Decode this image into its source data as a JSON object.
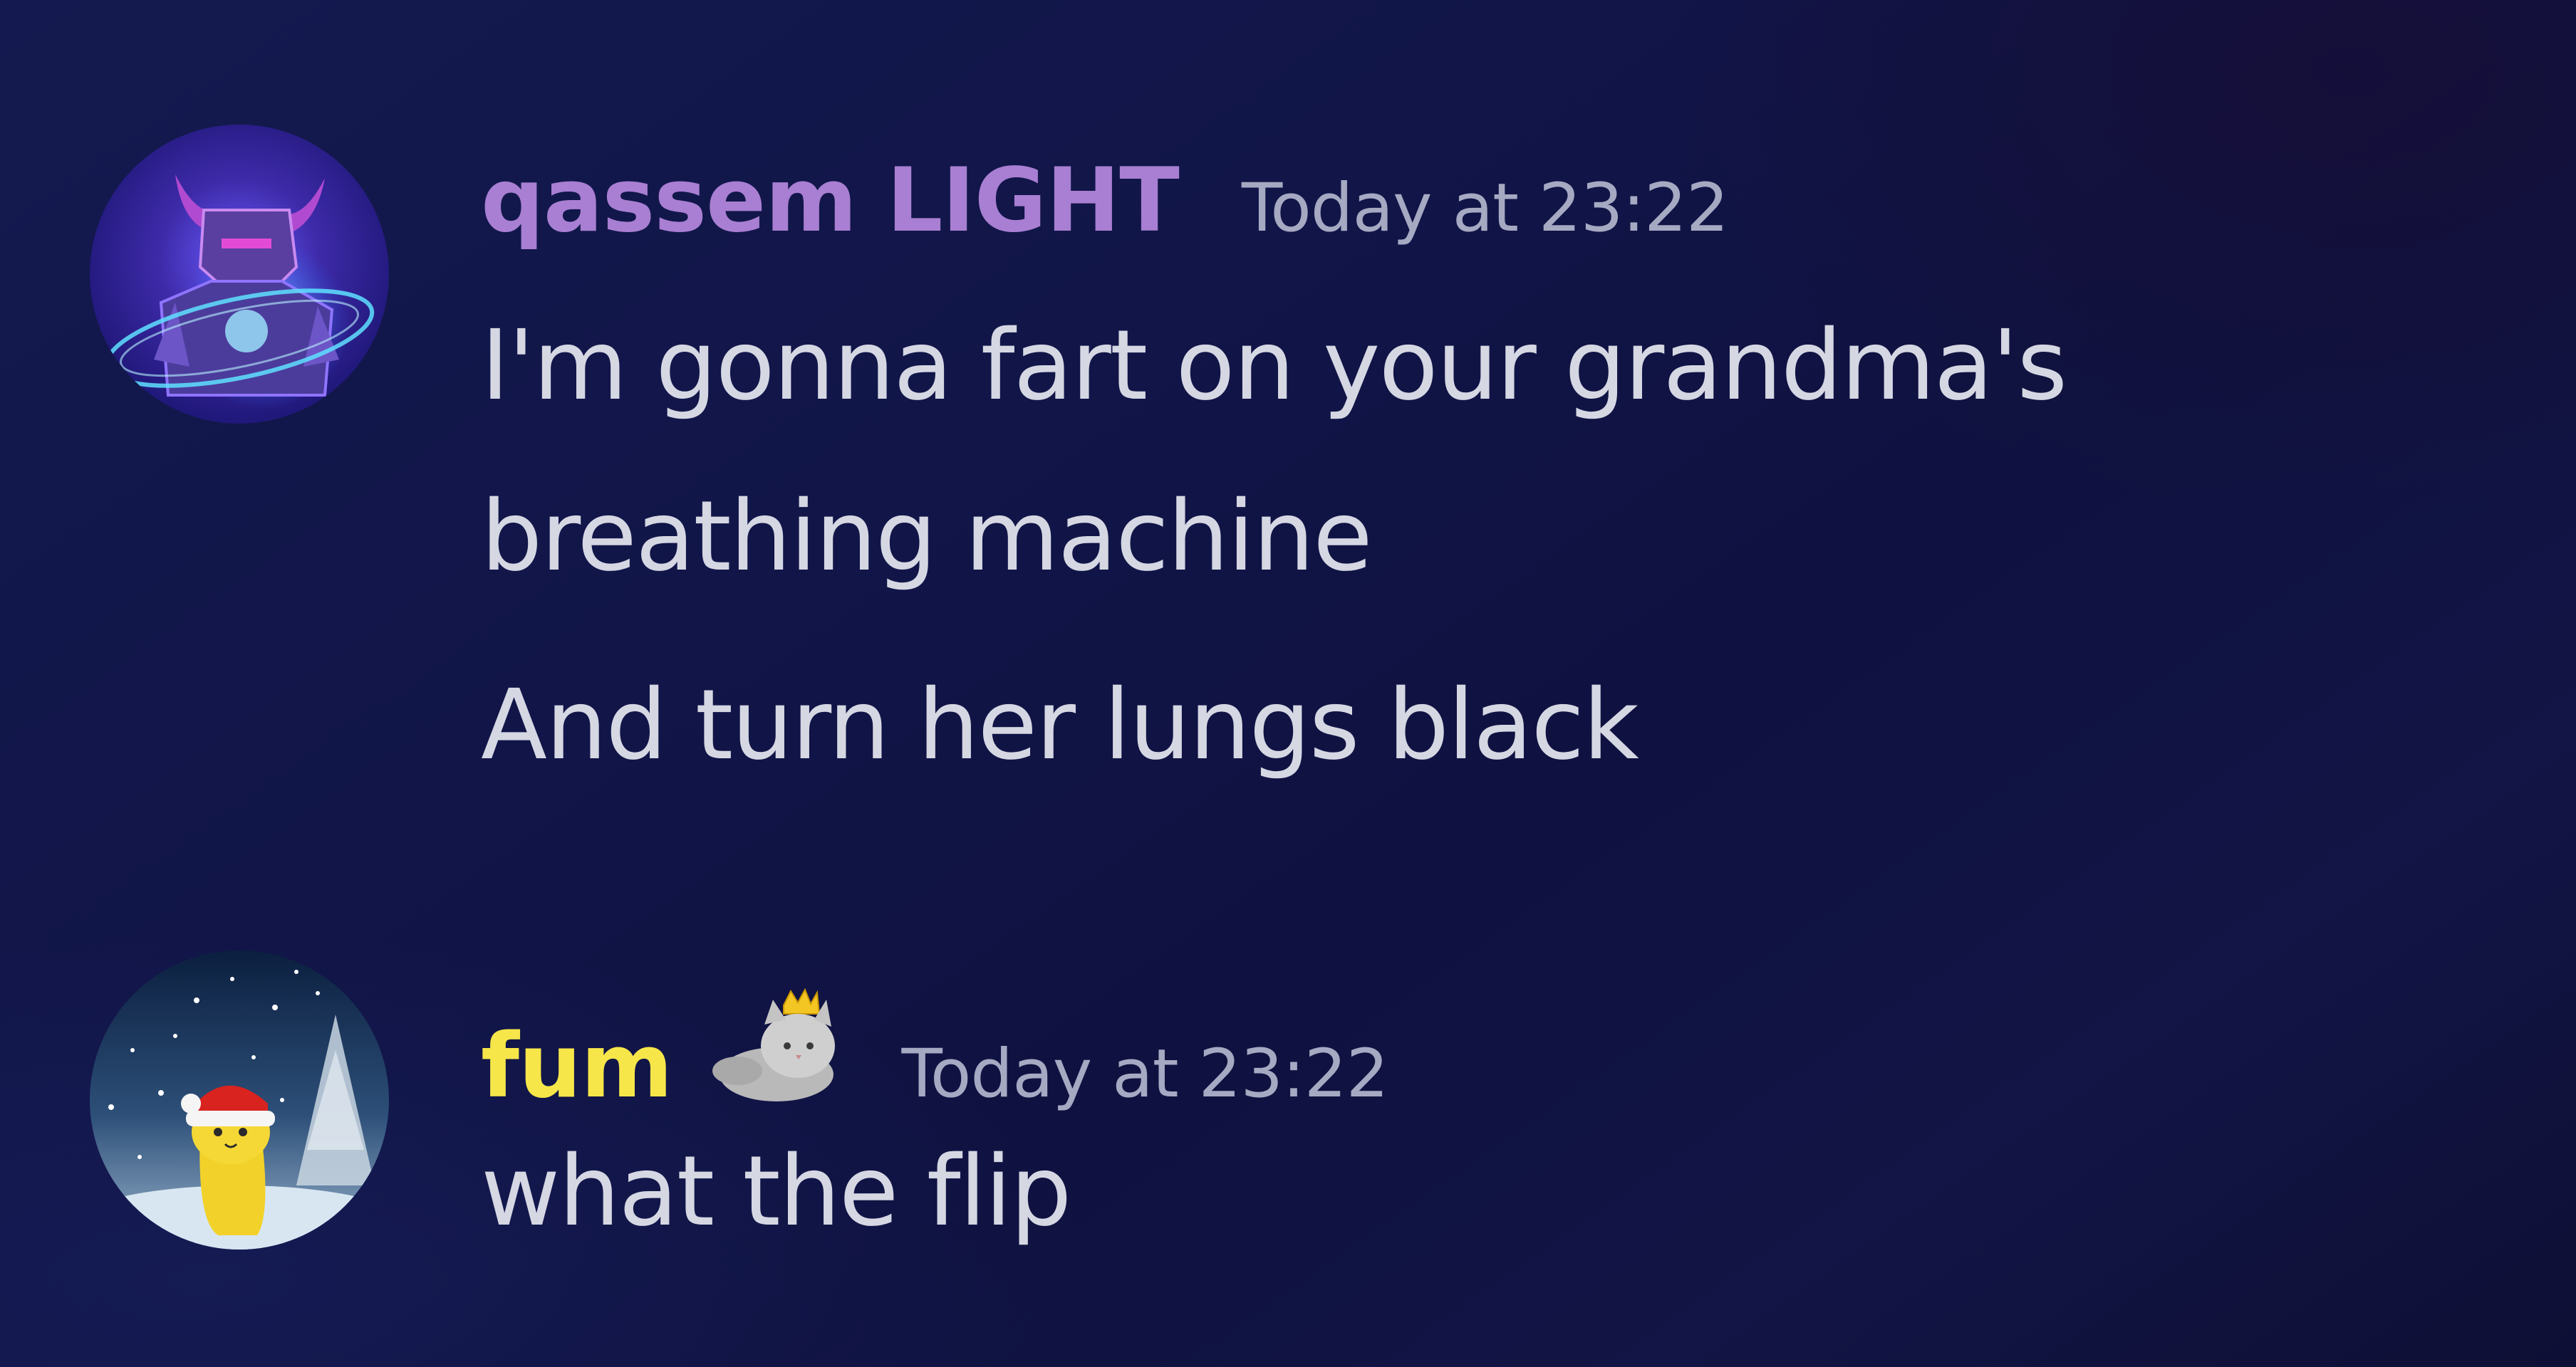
{
  "messages": [
    {
      "author": "qassem LIGHT",
      "author_color": "#a87fd2",
      "avatar_icon": "armored-knight-avatar",
      "timestamp": "Today at 23:22",
      "lines": [
        "I'm gonna fart on your grandma's",
        "breathing machine",
        "And turn her lungs black"
      ]
    },
    {
      "author": "fum",
      "author_color": "#f6e64a",
      "avatar_icon": "banana-cat-santa-hat-avatar",
      "role_icon": "crowned-cat-icon",
      "timestamp": "Today at 23:22",
      "lines": [
        "what the flip"
      ]
    }
  ],
  "colors": {
    "background": "#111548",
    "message_text": "#d5d7e3",
    "timestamp": "#a6a9c2"
  }
}
